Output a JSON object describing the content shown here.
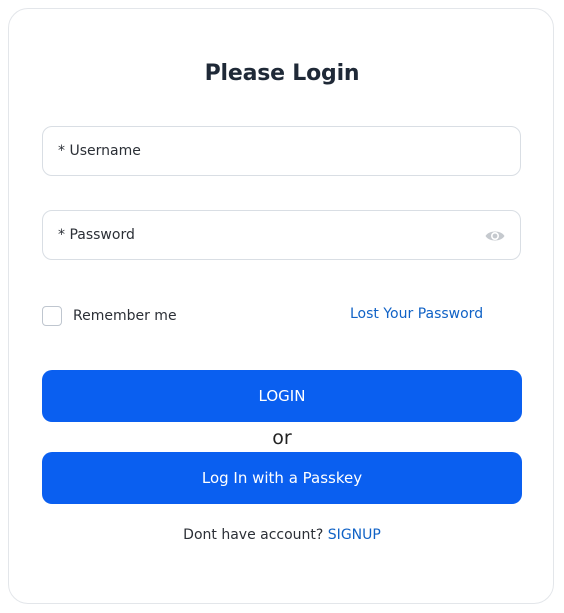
{
  "form": {
    "title": "Please Login",
    "username": {
      "label": "* Username",
      "value": ""
    },
    "password": {
      "label": "* Password",
      "value": "",
      "toggle_icon": "eye-icon"
    },
    "remember_label": "Remember me",
    "remember_checked": false,
    "lost_password_label": "Lost Your Password",
    "login_button_label": "LOGIN",
    "divider_text": "or",
    "passkey_button_label": "Log In with a Passkey",
    "signup_prompt": "Dont have account?",
    "signup_link_label": "SIGNUP"
  },
  "colors": {
    "primary": "#0a5ff0",
    "link": "#1062c6",
    "title": "#1f2937",
    "border": "#d9dee4"
  }
}
